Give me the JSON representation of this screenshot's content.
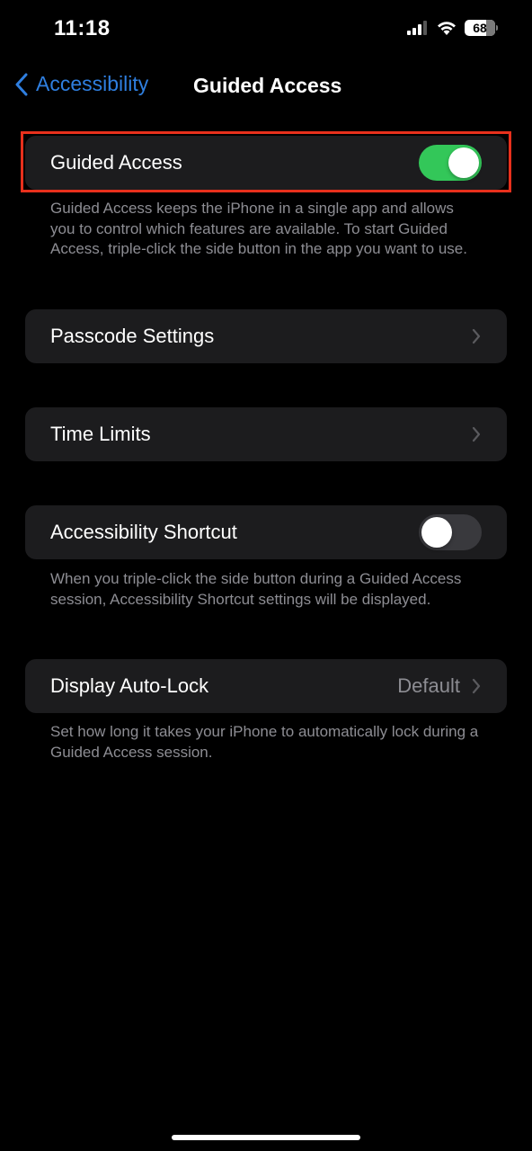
{
  "status_bar": {
    "time": "11:18",
    "battery_level": "68",
    "icons": [
      "cellular-signal-icon",
      "wifi-icon",
      "battery-icon"
    ]
  },
  "nav": {
    "back_label": "Accessibility",
    "title": "Guided Access"
  },
  "settings": {
    "guided_access": {
      "label": "Guided Access",
      "enabled": true,
      "footnote": "Guided Access keeps the iPhone in a single app and allows you to control which features are available. To start Guided Access, triple-click the side button in the app you want to use."
    },
    "passcode_settings": {
      "label": "Passcode Settings"
    },
    "time_limits": {
      "label": "Time Limits"
    },
    "accessibility_shortcut": {
      "label": "Accessibility Shortcut",
      "enabled": false,
      "footnote": "When you triple-click the side button during a Guided Access session, Accessibility Shortcut settings will be displayed."
    },
    "display_auto_lock": {
      "label": "Display Auto-Lock",
      "value": "Default",
      "footnote": "Set how long it takes your iPhone to automatically lock during a Guided Access session."
    }
  },
  "colors": {
    "accent": "#2f7fe0",
    "toggle_on": "#33c759",
    "highlight": "#e8301c"
  }
}
